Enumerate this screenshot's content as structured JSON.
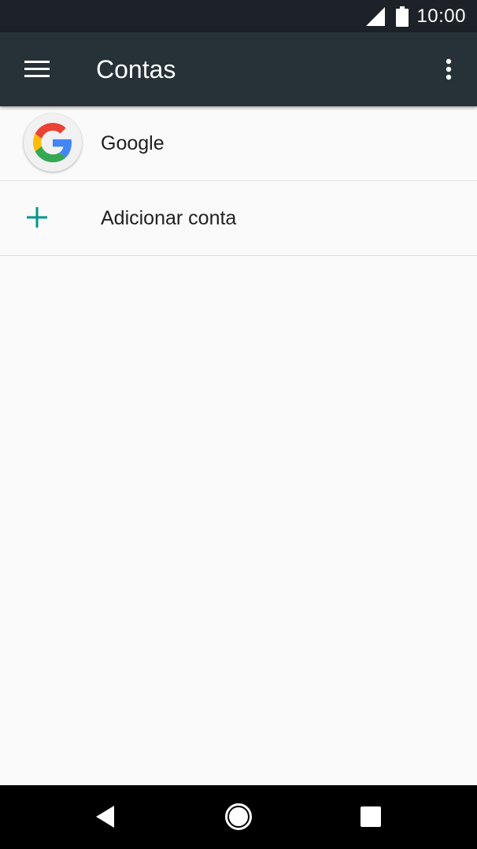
{
  "status_bar": {
    "time": "10:00",
    "icons": [
      "signal-icon",
      "battery-icon"
    ]
  },
  "app_bar": {
    "title": "Contas",
    "icons": [
      "menu-icon",
      "more-vert-icon"
    ],
    "background": "#263238"
  },
  "accounts": {
    "items": [
      {
        "label": "Google",
        "icon": "google-logo-icon"
      },
      {
        "label": "Adicionar conta",
        "icon": "add-icon",
        "icon_color": "#009688"
      }
    ]
  },
  "nav_bar": {
    "icons": [
      "back-icon",
      "home-icon",
      "recents-icon"
    ]
  }
}
